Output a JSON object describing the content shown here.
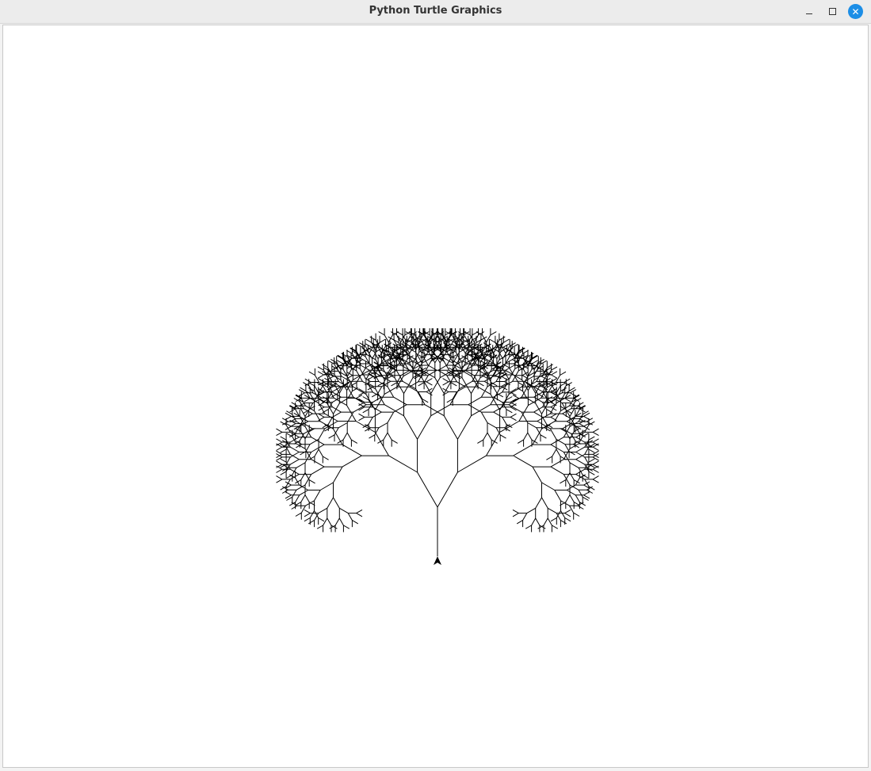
{
  "window": {
    "title": "Python Turtle Graphics",
    "controls": {
      "minimize": "minimize-icon",
      "maximize": "maximize-icon",
      "close": "close-icon"
    }
  },
  "canvas": {
    "background": "#ffffff",
    "pen_color": "#000000",
    "drawing": "fractal tree",
    "turtle_icon": "arrow-turtle-icon"
  }
}
